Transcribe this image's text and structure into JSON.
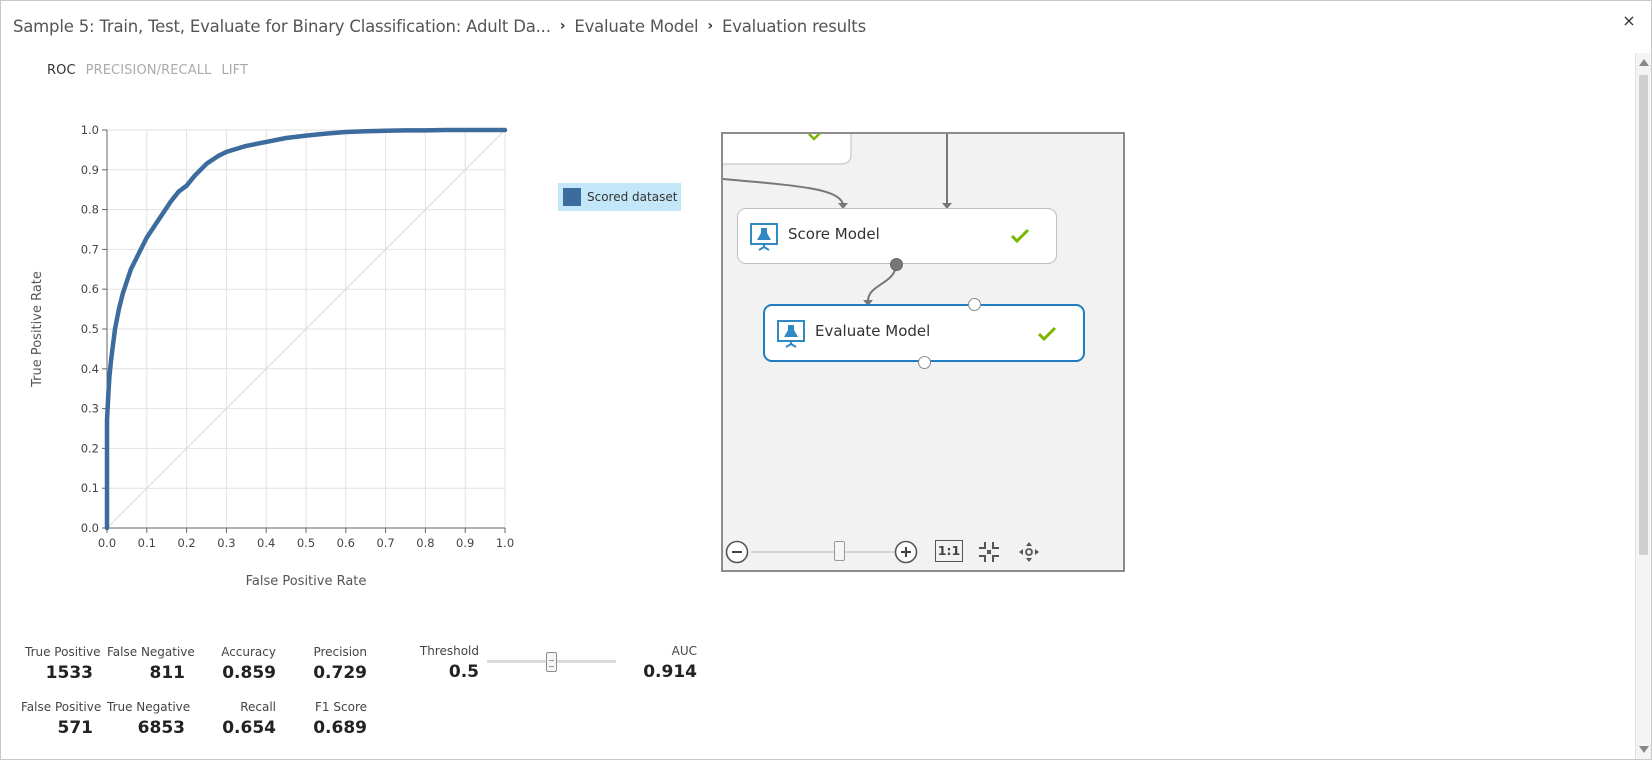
{
  "breadcrumb": {
    "experiment": "Sample 5: Train, Test, Evaluate for Binary Classification: Adult Da...",
    "module": "Evaluate Model",
    "page": "Evaluation results",
    "separator": "›"
  },
  "close_label": "×",
  "tabs": [
    {
      "label": "ROC",
      "active": true
    },
    {
      "label": "PRECISION/RECALL",
      "active": false
    },
    {
      "label": "LIFT",
      "active": false
    }
  ],
  "legend": {
    "label": "Scored dataset",
    "color": "#3c6b9e",
    "highlight": "#c3e7f8"
  },
  "workflow": {
    "nodes": [
      {
        "label": "Score Model",
        "status": "completed",
        "selected": false
      },
      {
        "label": "Evaluate Model",
        "status": "completed",
        "selected": true
      }
    ],
    "toolbar": {
      "fit_label": "1:1",
      "zoom_level": 0.55
    }
  },
  "metrics": {
    "true_positive": {
      "label": "True Positive",
      "value": "1533"
    },
    "false_negative": {
      "label": "False Negative",
      "value": "811"
    },
    "accuracy": {
      "label": "Accuracy",
      "value": "0.859"
    },
    "precision": {
      "label": "Precision",
      "value": "0.729"
    },
    "false_positive": {
      "label": "False Positive",
      "value": "571"
    },
    "true_negative": {
      "label": "True Negative",
      "value": "6853"
    },
    "recall": {
      "label": "Recall",
      "value": "0.654"
    },
    "f1_score": {
      "label": "F1 Score",
      "value": "0.689"
    },
    "threshold": {
      "label": "Threshold",
      "value": "0.5",
      "position": 0.5
    },
    "auc": {
      "label": "AUC",
      "value": "0.914"
    }
  },
  "chart_data": {
    "type": "line",
    "xlabel": "False Positive Rate",
    "ylabel": "True Positive Rate",
    "xlim": [
      0,
      1
    ],
    "ylim": [
      0,
      1
    ],
    "x_ticks": [
      "0.0",
      "0.1",
      "0.2",
      "0.3",
      "0.4",
      "0.5",
      "0.6",
      "0.7",
      "0.8",
      "0.9",
      "1.0"
    ],
    "y_ticks": [
      "0.0",
      "0.1",
      "0.2",
      "0.3",
      "0.4",
      "0.5",
      "0.6",
      "0.7",
      "0.8",
      "0.9",
      "1.0"
    ],
    "grid": true,
    "diagonal": true,
    "series": [
      {
        "name": "Scored dataset",
        "color": "#3c6b9e",
        "x": [
          0,
          0,
          0.003,
          0.006,
          0.01,
          0.015,
          0.02,
          0.03,
          0.04,
          0.05,
          0.06,
          0.07,
          0.08,
          0.1,
          0.12,
          0.14,
          0.16,
          0.18,
          0.2,
          0.22,
          0.25,
          0.28,
          0.3,
          0.35,
          0.4,
          0.45,
          0.5,
          0.55,
          0.6,
          0.65,
          0.7,
          0.75,
          0.8,
          0.85,
          0.9,
          0.95,
          1.0
        ],
        "y": [
          0,
          0.27,
          0.33,
          0.38,
          0.42,
          0.46,
          0.5,
          0.55,
          0.59,
          0.62,
          0.65,
          0.67,
          0.69,
          0.73,
          0.76,
          0.79,
          0.82,
          0.845,
          0.86,
          0.885,
          0.915,
          0.935,
          0.945,
          0.96,
          0.97,
          0.98,
          0.986,
          0.991,
          0.995,
          0.997,
          0.998,
          0.999,
          0.999,
          1.0,
          1.0,
          1.0,
          1.0
        ]
      }
    ]
  }
}
